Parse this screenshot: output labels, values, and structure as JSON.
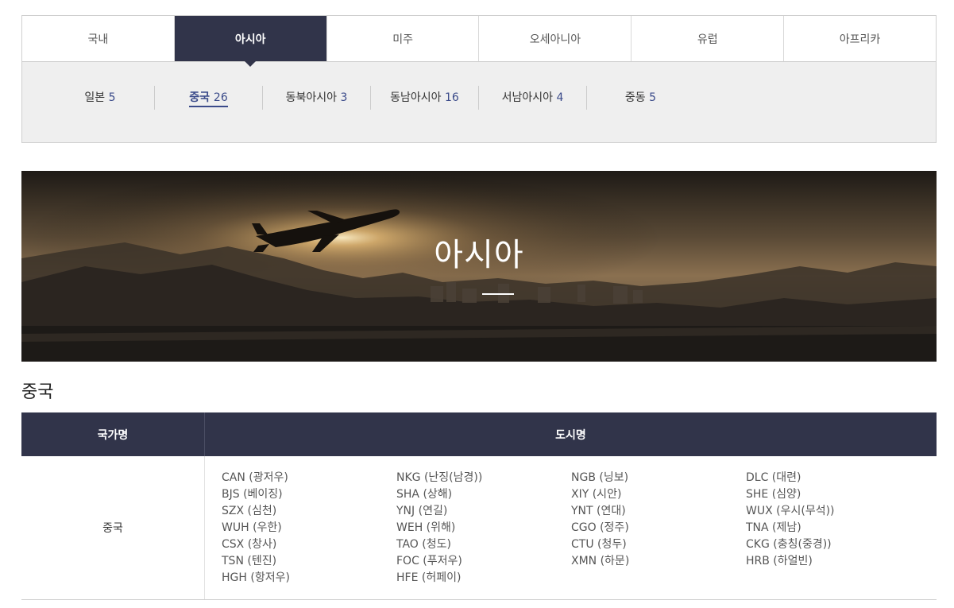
{
  "tabs": [
    {
      "label": "국내",
      "active": false
    },
    {
      "label": "아시아",
      "active": true
    },
    {
      "label": "미주",
      "active": false
    },
    {
      "label": "오세아니아",
      "active": false
    },
    {
      "label": "유럽",
      "active": false
    },
    {
      "label": "아프리카",
      "active": false
    }
  ],
  "subtabs": [
    {
      "label": "일본",
      "count": "5",
      "active": false
    },
    {
      "label": "중국",
      "count": "26",
      "active": true
    },
    {
      "label": "동북아시아",
      "count": "3",
      "active": false
    },
    {
      "label": "동남아시아",
      "count": "16",
      "active": false
    },
    {
      "label": "서남아시아",
      "count": "4",
      "active": false
    },
    {
      "label": "중동",
      "count": "5",
      "active": false
    }
  ],
  "banner": {
    "title": "아시아"
  },
  "section": {
    "title": "중국"
  },
  "table": {
    "headers": {
      "country": "국가명",
      "city": "도시명"
    },
    "country": "중국",
    "columns": [
      [
        "CAN (광저우)",
        "BJS (베이징)",
        "SZX (심천)",
        "WUH (우한)",
        "CSX (창사)",
        "TSN (텐진)",
        "HGH (항저우)"
      ],
      [
        "NKG (난징(남경))",
        "SHA (상해)",
        "YNJ (연길)",
        "WEH (위해)",
        "TAO (청도)",
        "FOC (푸저우)",
        "HFE (허페이)"
      ],
      [
        "NGB (닝보)",
        "XIY (시안)",
        "YNT (연대)",
        "CGO (정주)",
        "CTU (청두)",
        "XMN (하문)"
      ],
      [
        "DLC (대련)",
        "SHE (심양)",
        "WUX (우시(무석))",
        "TNA (제남)",
        "CKG (충칭(중경))",
        "HRB (하얼빈)"
      ]
    ]
  },
  "colors": {
    "navy": "#31344a",
    "accent": "#3b4b8a",
    "subtab_bg": "#efefef"
  }
}
